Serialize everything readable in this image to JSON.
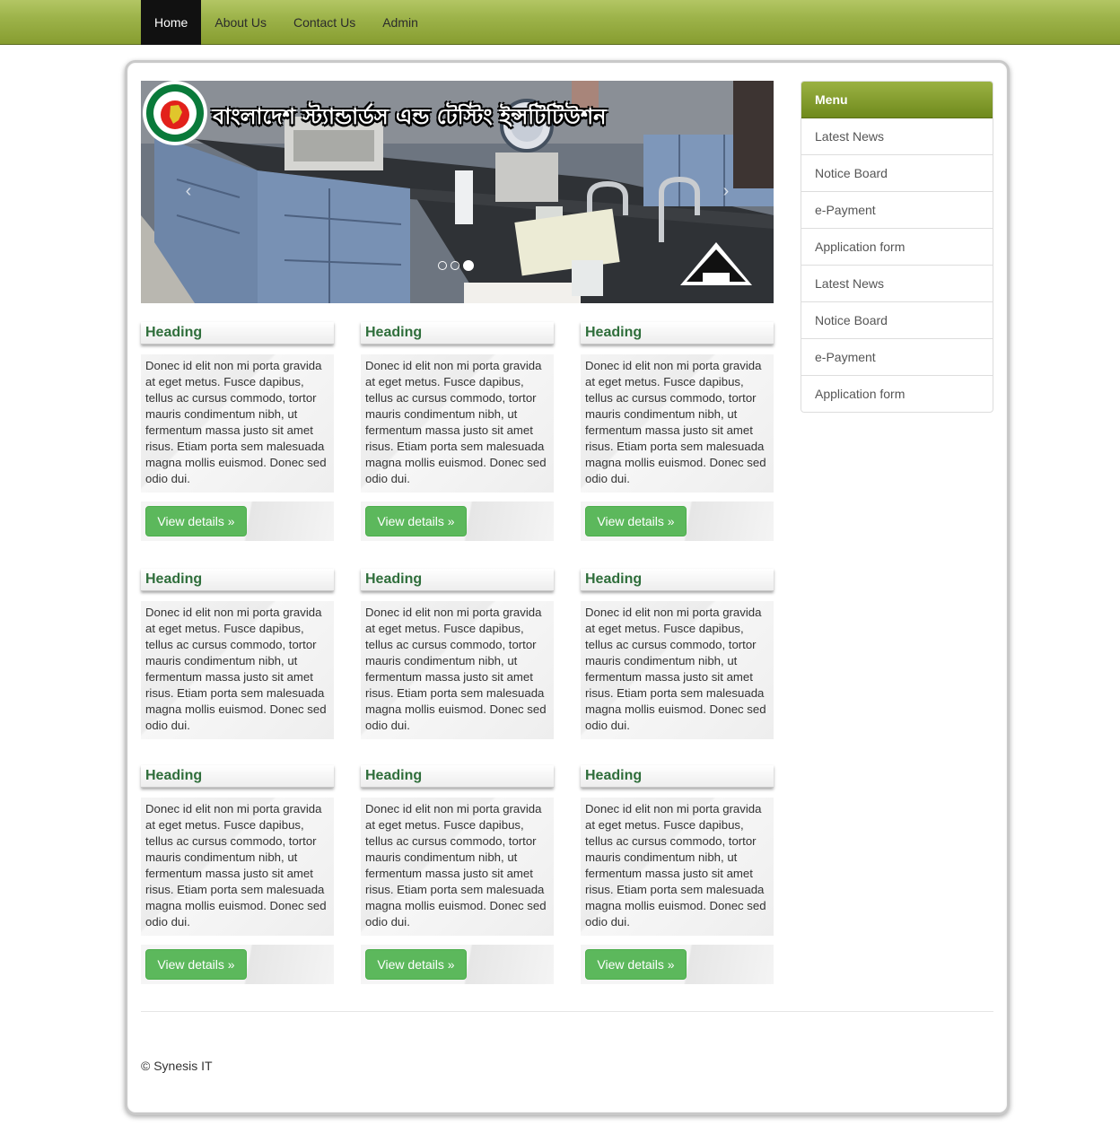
{
  "navbar": {
    "items": [
      {
        "label": "Home",
        "active": true
      },
      {
        "label": "About Us"
      },
      {
        "label": "Contact Us"
      },
      {
        "label": "Admin"
      }
    ]
  },
  "carousel": {
    "banner_title": "বাংলাদেশ স্ট্যান্ডার্ডস এন্ড টেস্টিং ইন্সটিটিউশন",
    "logo_text": "BSTI",
    "prev_glyph": "‹",
    "next_glyph": "›",
    "slide_count": 3,
    "active_slide": 3
  },
  "cards": {
    "heading": "Heading",
    "body": "Donec id elit non mi porta gravida at eget metus. Fusce dapibus, tellus ac cursus commodo, tortor mauris condimentum nibh, ut fermentum massa justo sit amet risus. Etiam porta sem malesuada magna mollis euismod. Donec sed odio dui.",
    "button_label": "View details »"
  },
  "sidebar": {
    "title": "Menu",
    "items": [
      {
        "label": "Latest News"
      },
      {
        "label": "Notice Board"
      },
      {
        "label": "e-Payment"
      },
      {
        "label": "Application form"
      },
      {
        "label": "Latest News"
      },
      {
        "label": "Notice Board"
      },
      {
        "label": "e-Payment"
      },
      {
        "label": "Application form"
      }
    ]
  },
  "footer": {
    "copyright": "© Synesis IT"
  },
  "colors": {
    "navbar": "#9db34a",
    "heading_green": "#2f6e3b",
    "button_green": "#5cb85c"
  }
}
